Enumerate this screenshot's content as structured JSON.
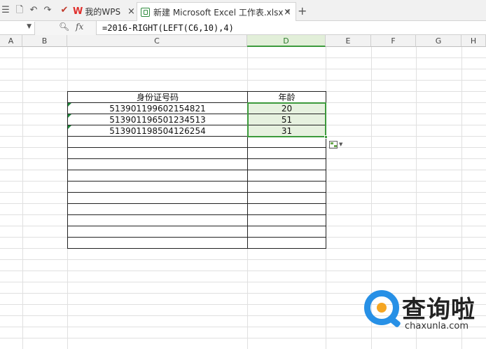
{
  "tabs": [
    {
      "label": "我的WPS"
    },
    {
      "label": "新建 Microsoft Excel 工作表.xlsx *"
    }
  ],
  "formula_bar": {
    "name_box": "",
    "fx_label": "fx",
    "formula": "=2016-RIGHT(LEFT(C6,10),4)"
  },
  "columns": [
    "A",
    "B",
    "C",
    "D",
    "E",
    "F",
    "G",
    "H"
  ],
  "selected_column": "D",
  "table": {
    "headers": [
      "身份证号码",
      "年龄"
    ],
    "rows": [
      {
        "id": "513901199602154821",
        "age": "20"
      },
      {
        "id": "513901196501234513",
        "age": "51"
      },
      {
        "id": "513901198504126254",
        "age": "31"
      }
    ]
  },
  "watermark": {
    "title": "查询啦",
    "subtitle": "chaxunla.com"
  },
  "icons": {
    "toolbar": [
      "menu-icon",
      "print-preview-icon",
      "undo-icon",
      "redo-icon",
      "pin-icon"
    ],
    "tab_close": "close-icon",
    "new_tab": "plus-icon",
    "smart_tag": "paste-options-icon"
  },
  "colors": {
    "selection": "#3c9a3c",
    "selection_fill": "#e6f1df",
    "wps_red": "#e0302d",
    "watermark_blue": "#2790e6",
    "watermark_orange": "#f5a623"
  }
}
